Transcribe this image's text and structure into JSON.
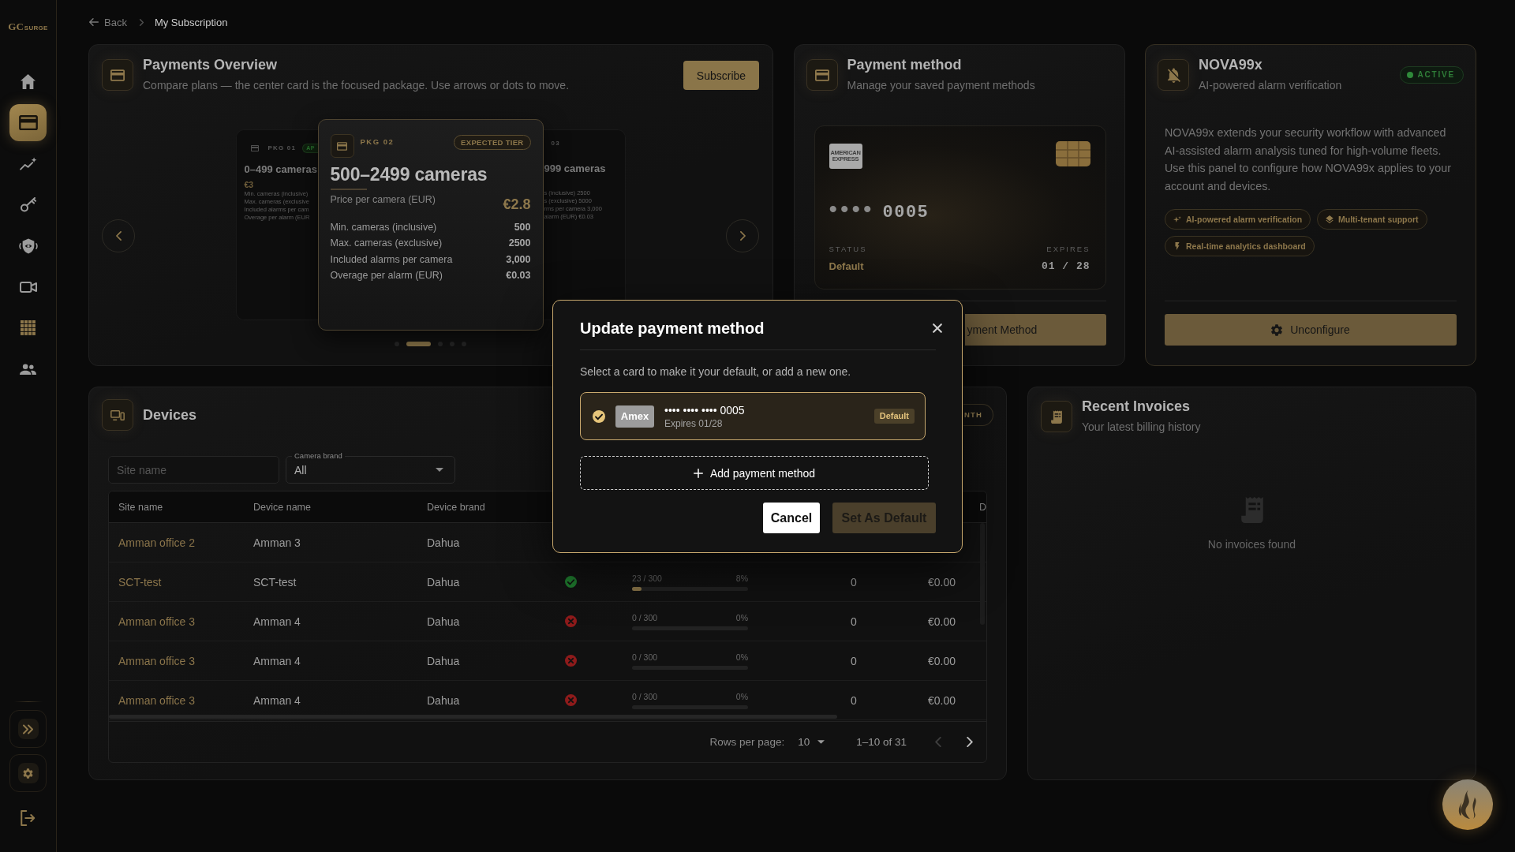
{
  "sidebar": {
    "logo": {
      "mark": "GC",
      "name": "SURGE"
    },
    "nav": [
      {
        "kind": "home",
        "selected": false
      },
      {
        "kind": "card",
        "selected": true
      },
      {
        "kind": "chart",
        "selected": false
      },
      {
        "kind": "key",
        "selected": false
      },
      {
        "kind": "shield",
        "selected": false
      },
      {
        "kind": "video",
        "selected": false
      },
      {
        "kind": "grid",
        "selected": false
      },
      {
        "kind": "people",
        "selected": false
      }
    ],
    "tools": [
      {
        "kind": "expand"
      },
      {
        "kind": "settings"
      },
      {
        "kind": "logout"
      }
    ]
  },
  "breadcrumb": {
    "back": "Back",
    "current": "My Subscription"
  },
  "payments_overview": {
    "title": "Payments Overview",
    "subtitle": "Compare plans — the center card is the focused package. Use arrows or dots to move.",
    "subscribe_button": "Subscribe",
    "packages": [
      {
        "kind": "left",
        "label": "PKG 01",
        "badge": "AP",
        "title": "0–499 cameras",
        "price": "€3",
        "rows": [
          "Min. cameras (inclusive)",
          "Max. cameras (exclusive",
          "Included alarms per cam",
          "Overage per alarm (EUR"
        ]
      },
      {
        "kind": "focused",
        "label": "PKG 02",
        "badge": "EXPECTED TIER",
        "title": "500–2499 cameras",
        "price_label": "Price per camera (EUR)",
        "price": "€2.8",
        "rows": [
          {
            "label": "Min. cameras (inclusive)",
            "value": "500"
          },
          {
            "label": "Max. cameras (exclusive)",
            "value": "2500"
          },
          {
            "label": "Included alarms per camera",
            "value": "3,000"
          },
          {
            "label": "Overage per alarm (EUR)",
            "value": "€0.03"
          }
        ]
      },
      {
        "kind": "right",
        "label": "03",
        "title": "999 cameras",
        "rows": [
          "s (inclusive) 2500",
          "s (exclusive) 5000",
          "rms per camera 3,000",
          "alarm (EUR) €0.03"
        ]
      }
    ],
    "dots": [
      {
        "selected": false
      },
      {
        "selected": true
      },
      {
        "selected": false
      },
      {
        "selected": false
      },
      {
        "selected": false
      }
    ]
  },
  "payment_method": {
    "title": "Payment method",
    "subtitle": "Manage your saved payment methods",
    "card": {
      "logo": "AMERICAN EXPRESS",
      "mask": "••••",
      "last4": "0005",
      "status_label": "STATUS",
      "status": "Default",
      "expires_label": "EXPIRES",
      "expires": "01 / 28"
    },
    "button": "yment Method"
  },
  "nova": {
    "title": "NOVA99x",
    "subtitle": "AI-powered alarm verification",
    "badge": "ACTIVE",
    "description": "NOVA99x extends your security workflow with advanced AI-assisted alarm analysis tuned for high-volume fleets. Use this panel to configure how NOVA99x applies to your account and devices.",
    "features": [
      {
        "kind": "sparkle",
        "label": "AI-powered alarm verification"
      },
      {
        "kind": "layers",
        "label": "Multi-tenant support"
      },
      {
        "kind": "bolt",
        "label": "Real-time analytics dashboard"
      }
    ],
    "button": "Unconfigure"
  },
  "devices": {
    "title": "Devices",
    "badge": "NTH",
    "filters": {
      "site": {
        "placeholder": "Site name"
      },
      "brand": {
        "label": "Camera brand",
        "value": "All"
      }
    },
    "table": {
      "columns": [
        "Site name",
        "Device name",
        "Device brand",
        "D"
      ],
      "rows": [
        {
          "site": "Amman office 2",
          "device": "Amman 3",
          "brand": "Dahua"
        },
        {
          "site": "SCT-test",
          "device": "SCT-test",
          "brand": "Dahua",
          "online": true,
          "usage": "23 / 300",
          "percent": "8%",
          "level": 0.08,
          "count": "0",
          "amount": "€0.00"
        },
        {
          "site": "Amman office 3",
          "device": "Amman 4",
          "brand": "Dahua",
          "online": false,
          "usage": "0 / 300",
          "percent": "0%",
          "count": "0",
          "amount": "€0.00"
        },
        {
          "site": "Amman office 3",
          "device": "Amman 4",
          "brand": "Dahua",
          "online": false,
          "usage": "0 / 300",
          "percent": "0%",
          "count": "0",
          "amount": "€0.00"
        },
        {
          "site": "Amman office 3",
          "device": "Amman 4",
          "brand": "Dahua",
          "online": false,
          "usage": "0 / 300",
          "percent": "0%",
          "count": "0",
          "amount": "€0.00"
        }
      ]
    },
    "pagination": {
      "rows_per_page_label": "Rows per page:",
      "rows_per_page": "10",
      "range": "1–10 of 31",
      "prev_disabled": true,
      "next_disabled": false
    }
  },
  "invoices": {
    "title": "Recent Invoices",
    "subtitle": "Your latest billing history",
    "empty": "No invoices found"
  },
  "modal": {
    "title": "Update payment method",
    "description": "Select a card to make it your default, or add a new one.",
    "cards": [
      {
        "brand": "Amex",
        "number": "•••• •••• •••• 0005",
        "expires": "Expires 01/28",
        "badge": "Default",
        "selected": true
      }
    ],
    "add_button": "Add payment method",
    "cancel_button": "Cancel",
    "confirm_button": {
      "label": "Set As Default",
      "disabled": true
    }
  }
}
